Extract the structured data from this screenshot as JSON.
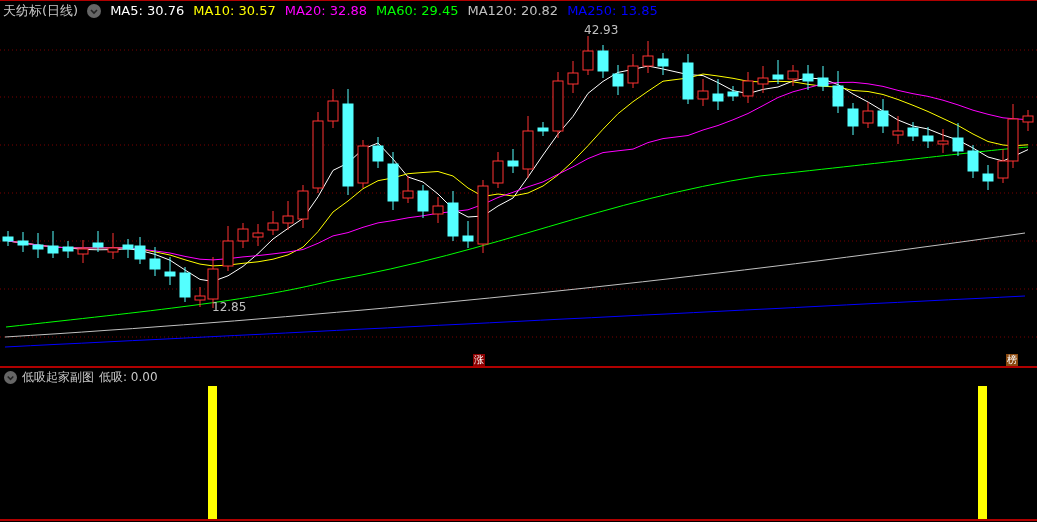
{
  "main_chart": {
    "title": "天纺标(日线)",
    "indicators": [
      {
        "label": "MA5:",
        "value": "30.76",
        "color": "#ffffff"
      },
      {
        "label": "MA10:",
        "value": "30.57",
        "color": "#ffff00"
      },
      {
        "label": "MA20:",
        "value": "32.88",
        "color": "#ff00ff"
      },
      {
        "label": "MA60:",
        "value": "29.45",
        "color": "#00ff00"
      },
      {
        "label": "MA120:",
        "value": "20.82",
        "color": "#c0c0c0"
      },
      {
        "label": "MA250:",
        "value": "13.85",
        "color": "#0000ff"
      }
    ],
    "high_label": "42.93",
    "low_label": "12.85"
  },
  "markers": [
    {
      "text": "涨",
      "color": "#8b0000"
    },
    {
      "text": "榜",
      "color": "#8b4a10"
    }
  ],
  "sub_chart": {
    "title": "低吸起家副图",
    "indicator": "低吸: 0.00"
  }
}
